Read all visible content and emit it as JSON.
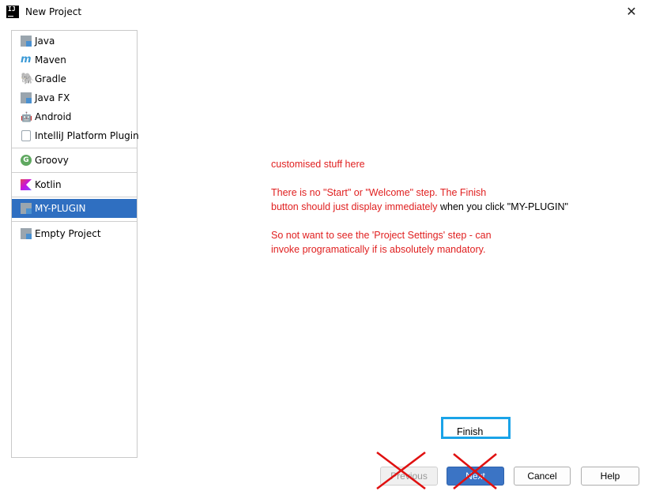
{
  "window": {
    "title": "New Project",
    "close_glyph": "✕",
    "app_icon_text": "IJ"
  },
  "sidebar": {
    "items": [
      {
        "label": "Java",
        "icon": "folder-icon"
      },
      {
        "label": "Maven",
        "icon": "maven-icon",
        "glyph": "m"
      },
      {
        "label": "Gradle",
        "icon": "gradle-icon",
        "glyph": "🐘"
      },
      {
        "label": "Java FX",
        "icon": "folder-icon"
      },
      {
        "label": "Android",
        "icon": "android-icon",
        "glyph": "🤖"
      },
      {
        "label": "IntelliJ Platform Plugin",
        "icon": "plugin-icon"
      },
      {
        "label": "Groovy",
        "icon": "groovy-icon",
        "glyph": "G"
      },
      {
        "label": "Kotlin",
        "icon": "kotlin-icon"
      },
      {
        "label": "MY-PLUGIN",
        "icon": "folder-icon",
        "selected": true
      },
      {
        "label": "Empty Project",
        "icon": "folder-icon"
      }
    ]
  },
  "notes": {
    "line1": "customised stuff here",
    "line2": "There is no \"Start\" or \"Welcome\" step. The Finish",
    "line3_red": "button should just display immediately",
    "line3_black": " when you click \"MY-PLUGIN\"",
    "line4": "So not want to see the 'Project Settings' step - can",
    "line5": "invoke programatically if is absolutely mandatory."
  },
  "finish_button": {
    "label": "Finish"
  },
  "buttons": {
    "previous": "Previous",
    "next": "Next",
    "cancel": "Cancel",
    "help": "Help"
  },
  "colors": {
    "selection": "#2f6fc1",
    "annotation_red": "#e02020",
    "finish_highlight": "#1aa3e8",
    "primary_button": "#3b74c5"
  }
}
